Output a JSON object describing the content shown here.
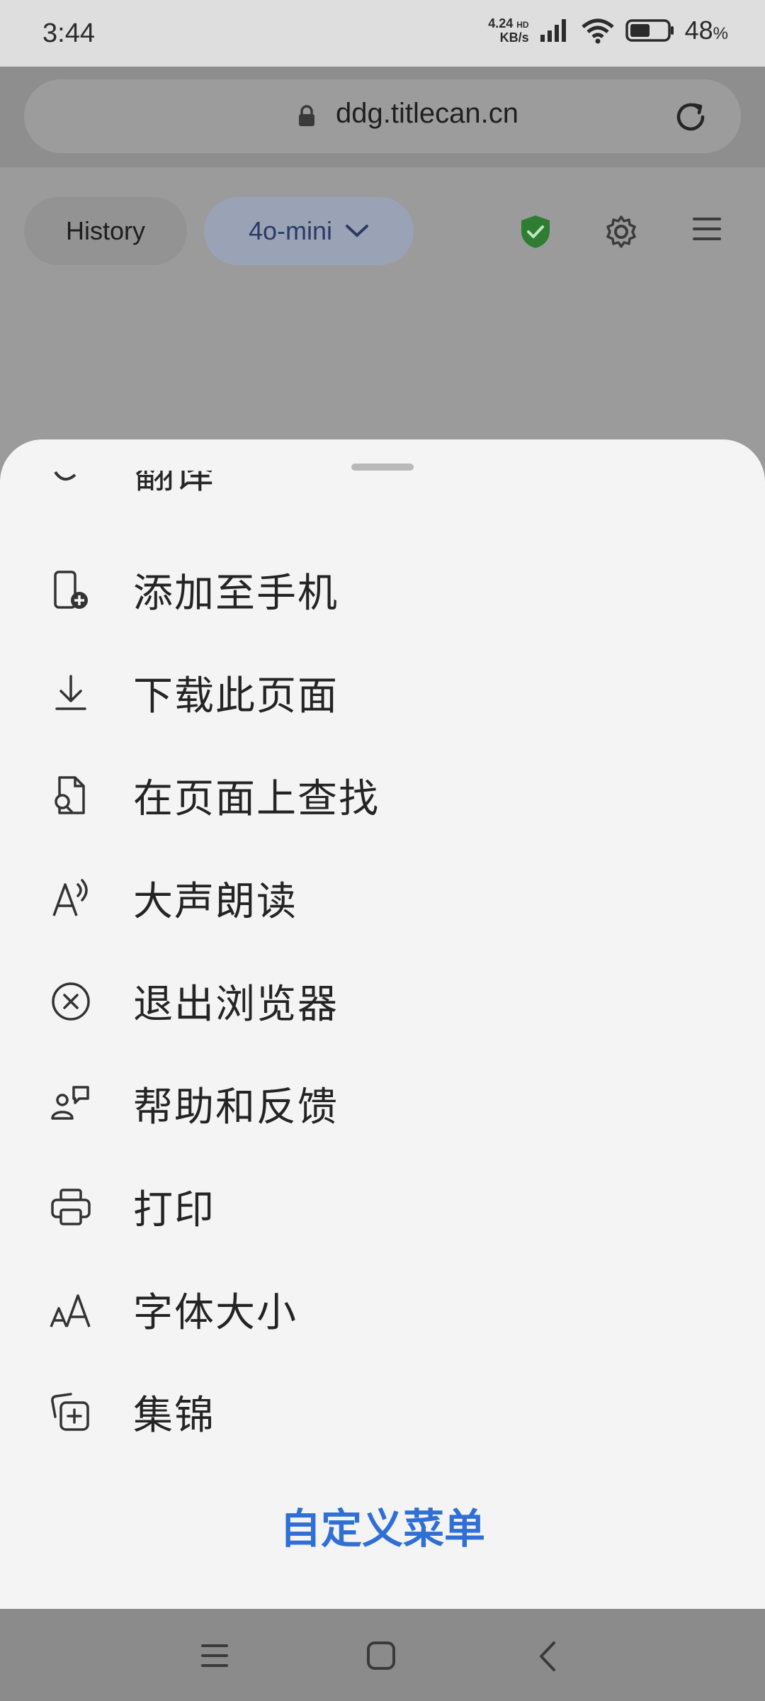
{
  "status_bar": {
    "time": "3:44",
    "speed_value": "4.24",
    "speed_unit": "KB/s",
    "network_badge": "HD",
    "battery_percent": "48",
    "battery_unit": "%"
  },
  "url_bar": {
    "url": "ddg.titlecan.cn"
  },
  "toolbar": {
    "history_label": "History",
    "model_label": "4o-mini"
  },
  "menu": {
    "partial_item": "翻译",
    "items": [
      {
        "label": "添加至手机",
        "icon": "phone-add-icon"
      },
      {
        "label": "下载此页面",
        "icon": "download-icon"
      },
      {
        "label": "在页面上查找",
        "icon": "find-in-page-icon"
      },
      {
        "label": "大声朗读",
        "icon": "read-aloud-icon"
      },
      {
        "label": "退出浏览器",
        "icon": "exit-icon"
      },
      {
        "label": "帮助和反馈",
        "icon": "help-feedback-icon"
      },
      {
        "label": "打印",
        "icon": "print-icon"
      },
      {
        "label": "字体大小",
        "icon": "font-size-icon"
      },
      {
        "label": "集锦",
        "icon": "collections-icon"
      }
    ],
    "customize_label": "自定义菜单"
  },
  "colors": {
    "accent": "#2f6fd6",
    "shield_green": "#2e7d32",
    "sheet_background": "#f4f4f4",
    "scrim": "#9b9b9b"
  }
}
